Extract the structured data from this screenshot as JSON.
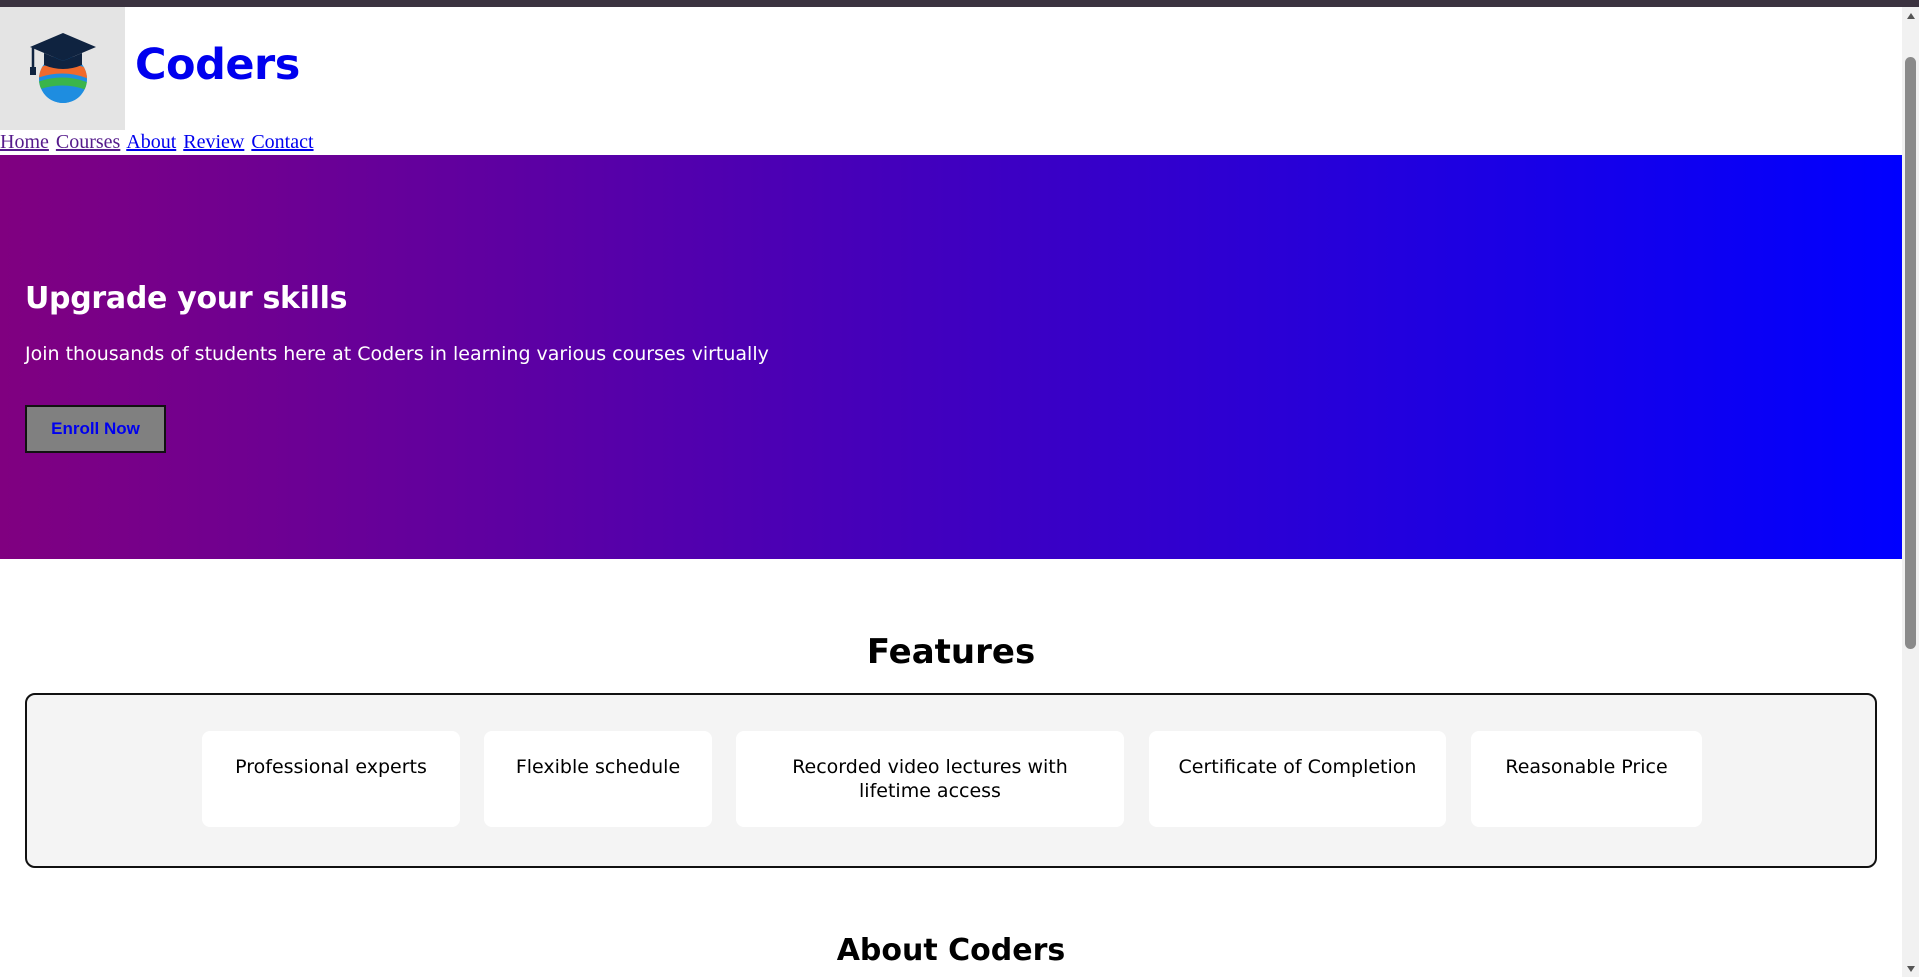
{
  "brand": {
    "name": "Coders",
    "logo_icon": "graduation-cap-globe-icon"
  },
  "nav": [
    {
      "label": "Home",
      "visited": true
    },
    {
      "label": "Courses",
      "visited": true
    },
    {
      "label": "About",
      "visited": false
    },
    {
      "label": "Review",
      "visited": false
    },
    {
      "label": "Contact",
      "visited": false
    }
  ],
  "hero": {
    "title": "Upgrade your skills",
    "subtitle": "Join thousands of students here at Coders in learning various courses virtually",
    "cta_label": "Enroll Now",
    "gradient_from": "#800080",
    "gradient_to": "#0000ff"
  },
  "features": {
    "title": "Features",
    "items": [
      "Professional experts",
      "Flexible schedule",
      "Recorded video lectures with lifetime access",
      "Certificate of Completion",
      "Reasonable Price"
    ]
  },
  "about": {
    "title": "About Coders"
  },
  "colors": {
    "link": "#0000ee",
    "visited_link": "#551a8b",
    "feature_panel": "#f4f4f4"
  }
}
